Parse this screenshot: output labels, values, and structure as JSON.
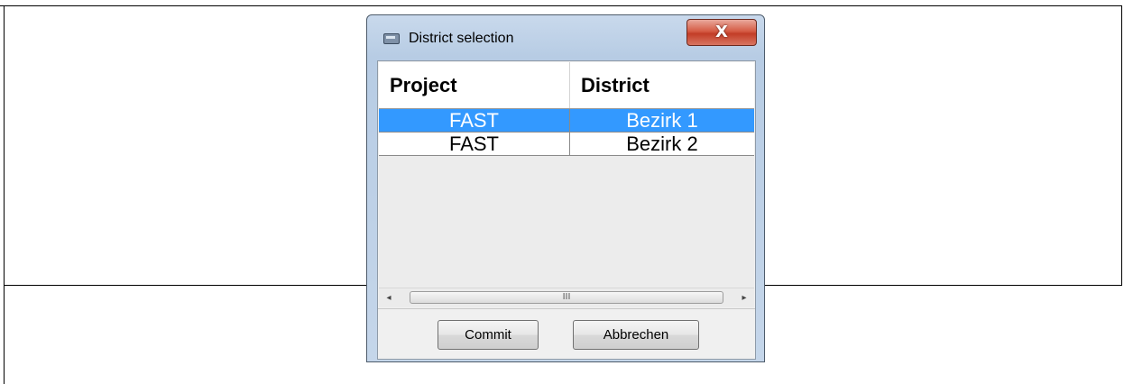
{
  "window": {
    "title": "District selection",
    "close_label": "X"
  },
  "grid": {
    "columns": [
      "Project",
      "District"
    ],
    "rows": [
      {
        "project": "FAST",
        "district": "Bezirk 1",
        "selected": true
      },
      {
        "project": "FAST",
        "district": "Bezirk 2",
        "selected": false
      }
    ],
    "selection_color": "#3399ff"
  },
  "scrollbar": {
    "left_arrow": "◂",
    "right_arrow": "▸",
    "thumb_grip": "III"
  },
  "buttons": {
    "commit_label": "Commit",
    "cancel_label": "Abbrechen"
  }
}
